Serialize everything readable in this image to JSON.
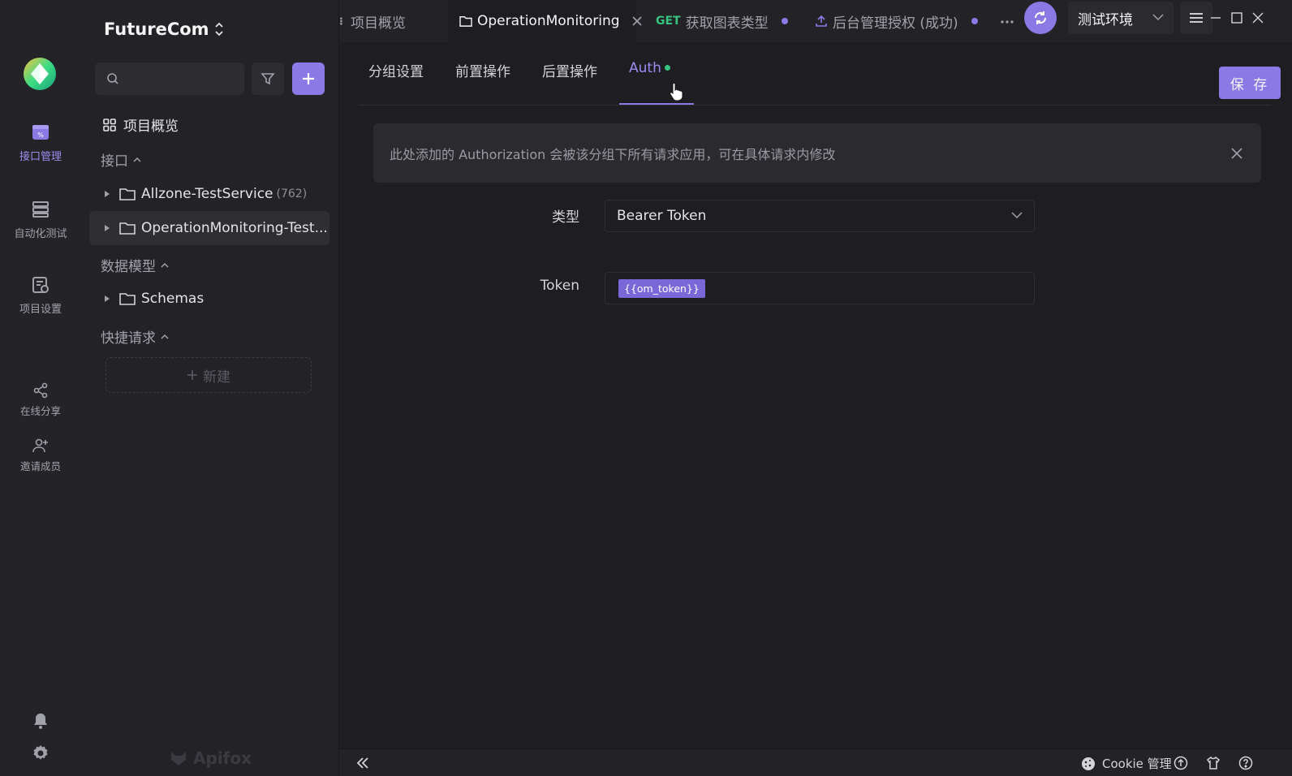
{
  "app": {
    "project_name": "FutureCom",
    "watermark": "Apifox"
  },
  "colors": {
    "accent": "#8b7ae6",
    "get_method": "#36c27f",
    "background": "#1e1e22",
    "sidebar": "#232327"
  },
  "rail": {
    "items": [
      {
        "label": "接口管理",
        "icon": "api-management-icon",
        "active": true
      },
      {
        "label": "自动化测试",
        "icon": "automation-test-icon",
        "active": false
      },
      {
        "label": "项目设置",
        "icon": "project-settings-icon",
        "active": false
      },
      {
        "label": "在线分享",
        "icon": "share-icon",
        "active": false
      },
      {
        "label": "邀请成员",
        "icon": "invite-member-icon",
        "active": false
      }
    ],
    "bottom_icons": [
      "bell-icon",
      "gear-icon"
    ]
  },
  "sidebar": {
    "search_placeholder": "",
    "overview_label": "项目概览",
    "sections": {
      "api": "接口",
      "models": "数据模型",
      "quick": "快捷请求"
    },
    "tree": [
      {
        "label": "Allzone-TestService",
        "count": "(762)"
      },
      {
        "label": "OperationMonitoring-Test...",
        "count": ""
      },
      {
        "label": "Schemas",
        "count": ""
      }
    ],
    "new_button": "新建"
  },
  "tabs": [
    {
      "label": "项目概览",
      "method": "",
      "active": false
    },
    {
      "label": "OperationMonitoring",
      "method": "",
      "active": true
    },
    {
      "label": "获取图表类型",
      "method": "GET",
      "active": false
    },
    {
      "label": "后台管理授权 (成功)",
      "method": "",
      "active": false
    }
  ],
  "environment": {
    "selected": "测试环境"
  },
  "subtabs": [
    {
      "label": "分组设置",
      "active": false
    },
    {
      "label": "前置操作",
      "active": false
    },
    {
      "label": "后置操作",
      "active": false
    },
    {
      "label": "Auth",
      "active": true
    }
  ],
  "save_button": "保 存",
  "notice": "此处添加的 Authorization 会被该分组下所有请求应用，可在具体请求内修改",
  "form": {
    "type_label": "类型",
    "type_value": "Bearer Token",
    "token_label": "Token",
    "token_value": "{{om_token}}"
  },
  "statusbar": {
    "cookie_label": "Cookie 管理"
  }
}
